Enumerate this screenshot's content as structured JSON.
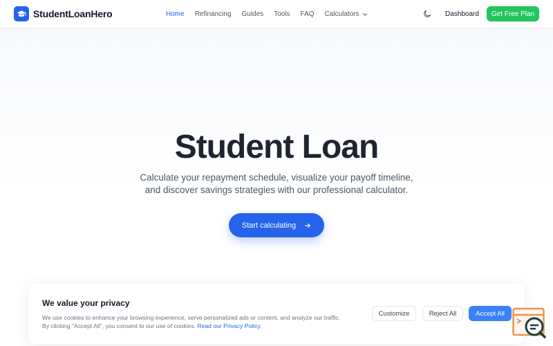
{
  "brand": {
    "name": "StudentLoanHero",
    "logo_icon": "graduation-cap-icon",
    "color": "#2563eb"
  },
  "nav": {
    "links": [
      {
        "label": "Home",
        "active": true
      },
      {
        "label": "Refinancing",
        "active": false
      },
      {
        "label": "Guides",
        "active": false
      },
      {
        "label": "Tools",
        "active": false
      },
      {
        "label": "FAQ",
        "active": false
      }
    ],
    "calculators_label": "Calculators",
    "theme_icon": "moon-icon",
    "dashboard_label": "Dashboard",
    "cta_label": "Get Free Plan",
    "cta_color": "#22c55e"
  },
  "hero": {
    "title": "Student Loan",
    "subtitle": "Calculate your repayment schedule, visualize your payoff timeline, and discover savings strategies with our professional calculator.",
    "button_label": "Start calculating",
    "button_icon": "arrow-right-icon"
  },
  "cookie": {
    "title": "We value your privacy",
    "text_line1": "We use cookies to enhance your browsing experience, serve personalized ads or content, and analyze our traffic.",
    "text_line2": "By clicking \"Accept All\", you consent to our use of cookies.",
    "policy_link": "Read our Privacy Policy.",
    "customize_label": "Customize",
    "reject_label": "Reject All",
    "accept_label": "Accept All"
  },
  "widget": {
    "icon": "chat-search-icon"
  }
}
